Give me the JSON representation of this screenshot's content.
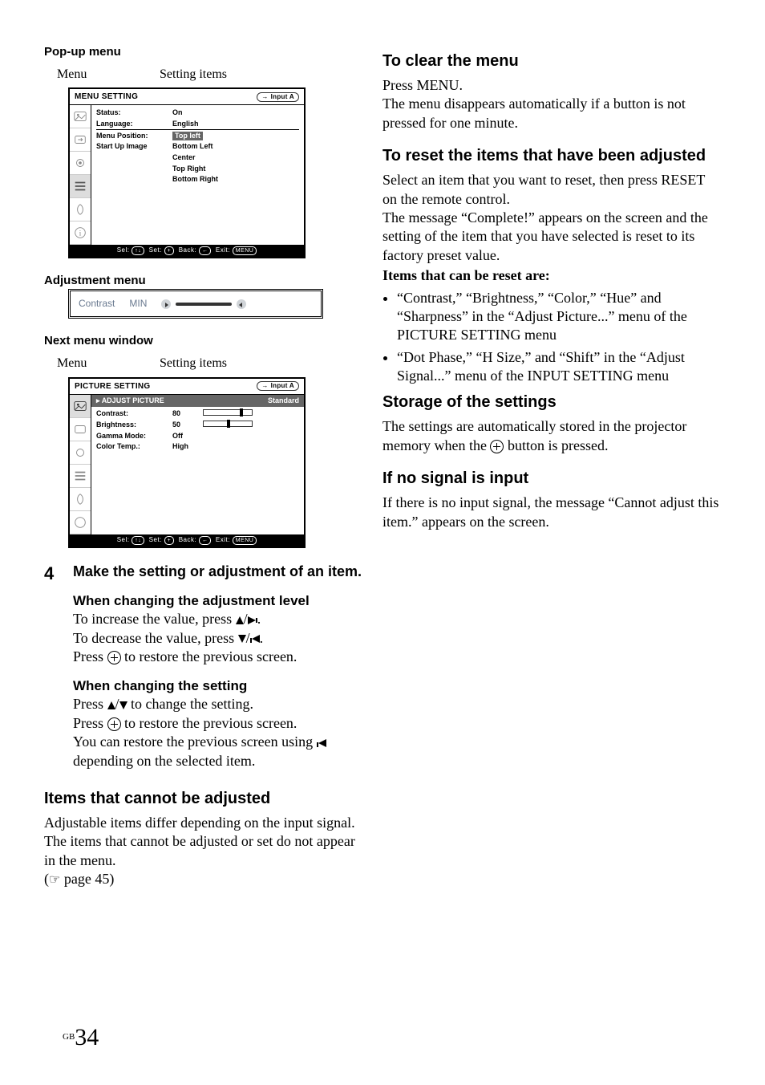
{
  "left": {
    "popup_heading": "Pop-up menu",
    "label_menu": "Menu",
    "label_items": "Setting items",
    "menu1": {
      "title": "MENU SETTING",
      "input": "Input A",
      "rows": [
        {
          "k": "Status:",
          "v": "On"
        },
        {
          "k": "Language:",
          "v": "English"
        },
        {
          "k": "Menu Position:",
          "v": "Top left"
        },
        {
          "k": "Start Up Image",
          "v": "Bottom Left"
        }
      ],
      "extra": [
        "Center",
        "Top Right",
        "Bottom Right"
      ],
      "foot": {
        "sel": "Sel:",
        "set": "Set:",
        "back": "Back:",
        "exit": "Exit:",
        "menu": "MENU"
      }
    },
    "adj_heading": "Adjustment menu",
    "adj": {
      "label": "Contrast",
      "min": "MIN"
    },
    "next_heading": "Next menu window",
    "menu2": {
      "title": "PICTURE SETTING",
      "input": "Input A",
      "section": "ADJUST PICTURE",
      "mode": "Standard",
      "rows": [
        {
          "k": "Contrast:",
          "v": "80"
        },
        {
          "k": "Brightness:",
          "v": "50"
        },
        {
          "k": "Gamma Mode:",
          "v": "Off"
        },
        {
          "k": "Color Temp.:",
          "v": "High"
        }
      ],
      "foot": {
        "sel": "Sel:",
        "set": "Set:",
        "back": "Back:",
        "exit": "Exit:",
        "menu": "MENU"
      }
    },
    "step4": {
      "num": "4",
      "title": "Make the setting or adjustment of an item.",
      "chg_level": "When changing the adjustment level",
      "inc_a": "To increase the value, press ",
      "inc_b": ".",
      "dec_a": "To decrease the value, press ",
      "dec_b": ".",
      "press_a": "Press ",
      "press_b": " to restore the previous screen.",
      "chg_set": "When changing the setting",
      "cs_a": "Press ",
      "cs_b": " to change the setting.",
      "cs2_a": "Press ",
      "cs2_b": " to restore the previous screen.",
      "cs3_a": "You can restore the previous screen using ",
      "cs3_b": " depending on the selected item."
    },
    "cannot_h": "Items that cannot be adjusted",
    "cannot_p": "Adjustable items differ depending on the input signal. The items that cannot be adjusted or set do not appear in the menu.",
    "cannot_ref": " page 45)"
  },
  "right": {
    "clear_h": "To clear the menu",
    "clear_p1": "Press MENU.",
    "clear_p2": "The menu disappears automatically if a button is not pressed for one minute.",
    "reset_h": "To reset the items that have been adjusted",
    "reset_p1": "Select an item that you want to reset, then press RESET on the remote control.",
    "reset_p2": "The message “Complete!” appears on the screen and the setting of the item that you have selected is reset to its factory preset value.",
    "reset_items_h": "Items that can be reset are:",
    "reset_li1": "“Contrast,” “Brightness,” “Color,” “Hue” and “Sharpness” in the “Adjust Picture...” menu of the PICTURE SETTING menu",
    "reset_li2": "“Dot Phase,” “H Size,” and “Shift” in the “Adjust Signal...” menu of the INPUT SETTING menu",
    "storage_h": "Storage of the settings",
    "storage_a": "The settings are automatically stored in the projector memory when the ",
    "storage_b": " button is pressed.",
    "nosig_h": "If no signal is input",
    "nosig_p": "If there is no input signal, the message “Cannot adjust this item.” appears on the screen."
  },
  "page": {
    "gb": "GB",
    "num": "34"
  }
}
